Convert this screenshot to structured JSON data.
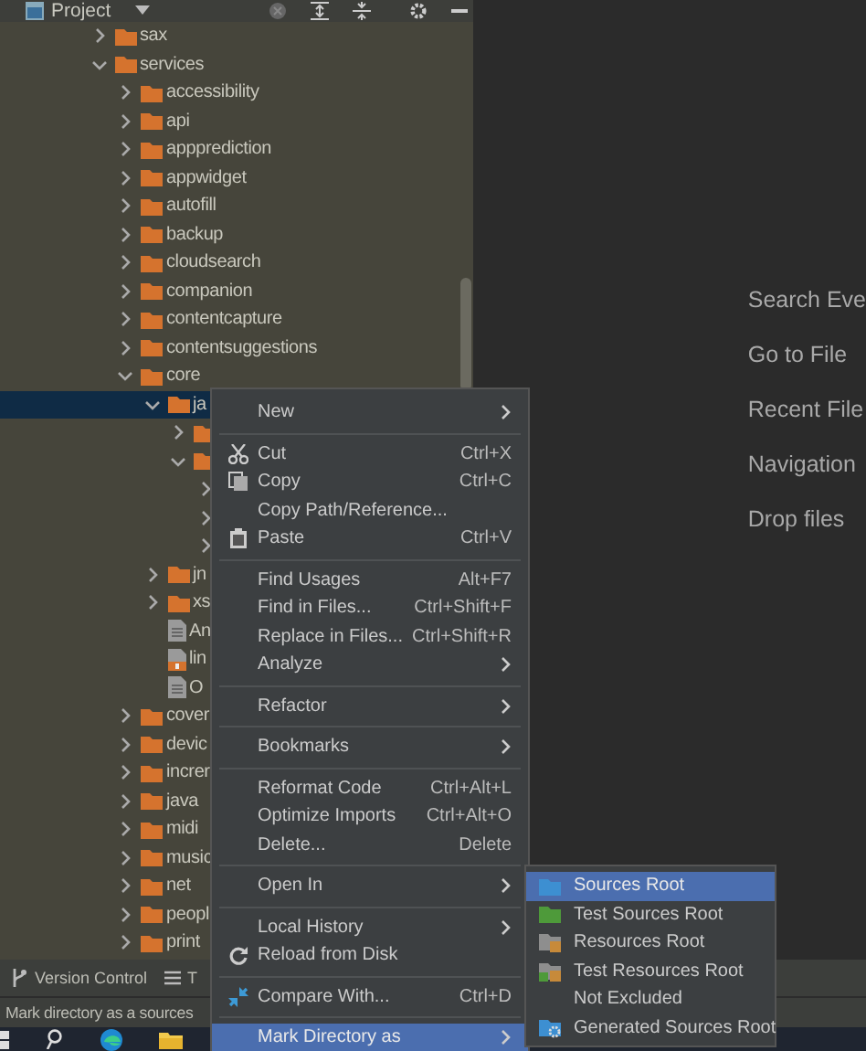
{
  "project_panel": {
    "title": "Project",
    "tree": [
      {
        "label": "sax",
        "kind": "folder",
        "expanded": false,
        "selected": false
      },
      {
        "label": "services",
        "kind": "folder",
        "expanded": true,
        "selected": false,
        "children": [
          {
            "label": "accessibility",
            "kind": "folder",
            "expanded": false,
            "selected": false
          },
          {
            "label": "api",
            "kind": "folder",
            "expanded": false,
            "selected": false
          },
          {
            "label": "appprediction",
            "kind": "folder",
            "expanded": false,
            "selected": false
          },
          {
            "label": "appwidget",
            "kind": "folder",
            "expanded": false,
            "selected": false
          },
          {
            "label": "autofill",
            "kind": "folder",
            "expanded": false,
            "selected": false
          },
          {
            "label": "backup",
            "kind": "folder",
            "expanded": false,
            "selected": false
          },
          {
            "label": "cloudsearch",
            "kind": "folder",
            "expanded": false,
            "selected": false
          },
          {
            "label": "companion",
            "kind": "folder",
            "expanded": false,
            "selected": false
          },
          {
            "label": "contentcapture",
            "kind": "folder",
            "expanded": false,
            "selected": false
          },
          {
            "label": "contentsuggestions",
            "kind": "folder",
            "expanded": false,
            "selected": false
          },
          {
            "label": "core",
            "kind": "folder",
            "expanded": true,
            "selected": false,
            "children": [
              {
                "label": "ja",
                "kind": "folder",
                "expanded": true,
                "selected": true,
                "children": [
                  {
                    "kind": "folder",
                    "expanded": false,
                    "selected": false
                  },
                  {
                    "kind": "folder",
                    "expanded": true,
                    "selected": false,
                    "children": [
                      {
                        "expanded": false,
                        "selected": false
                      },
                      {
                        "expanded": false,
                        "selected": false
                      },
                      {
                        "expanded": false,
                        "selected": false
                      }
                    ]
                  }
                ]
              },
              {
                "label": "jn",
                "kind": "folder",
                "expanded": false,
                "selected": false
              },
              {
                "label": "xs",
                "kind": "folder",
                "expanded": false,
                "selected": false
              },
              {
                "label": "An",
                "kind": "file",
                "selected": false
              },
              {
                "label": "lin",
                "kind": "archive-file",
                "selected": false
              },
              {
                "label": "O",
                "kind": "file",
                "selected": false
              }
            ]
          },
          {
            "label": "cover",
            "kind": "folder",
            "expanded": false,
            "selected": false
          },
          {
            "label": "devic",
            "kind": "folder",
            "expanded": false,
            "selected": false
          },
          {
            "label": "increr",
            "kind": "folder",
            "expanded": false,
            "selected": false
          },
          {
            "label": "java",
            "kind": "folder",
            "expanded": false,
            "selected": false
          },
          {
            "label": "midi",
            "kind": "folder",
            "expanded": false,
            "selected": false
          },
          {
            "label": "music",
            "kind": "folder",
            "expanded": false,
            "selected": false
          },
          {
            "label": "net",
            "kind": "folder",
            "expanded": false,
            "selected": false
          },
          {
            "label": "peopl",
            "kind": "folder",
            "expanded": false,
            "selected": false
          },
          {
            "label": "print",
            "kind": "folder",
            "expanded": false,
            "selected": false
          }
        ]
      }
    ]
  },
  "editor_hints": [
    "Search Eve",
    "Go to File",
    "Recent File",
    "Navigation",
    "Drop files"
  ],
  "tool_tabs": [
    {
      "label": "Version Control",
      "kind": "branch"
    },
    {
      "label": "T",
      "kind": "list"
    }
  ],
  "status_bar": "Mark directory as a sources",
  "context_menu": [
    {
      "kind": "submenu",
      "label": "New",
      "selected": false
    },
    {
      "kind": "separator"
    },
    {
      "kind": "cut",
      "label": "Cut",
      "shortcut": "Ctrl+X",
      "selected": false
    },
    {
      "kind": "copy",
      "label": "Copy",
      "shortcut": "Ctrl+C",
      "selected": false
    },
    {
      "kind": "item",
      "label": "Copy Path/Reference...",
      "selected": false
    },
    {
      "kind": "paste",
      "label": "Paste",
      "shortcut": "Ctrl+V",
      "selected": false
    },
    {
      "kind": "separator"
    },
    {
      "kind": "item",
      "label": "Find Usages",
      "shortcut": "Alt+F7",
      "selected": false
    },
    {
      "kind": "item",
      "label": "Find in Files...",
      "shortcut": "Ctrl+Shift+F",
      "selected": false
    },
    {
      "kind": "item",
      "label": "Replace in Files...",
      "shortcut": "Ctrl+Shift+R",
      "selected": false
    },
    {
      "kind": "submenu",
      "label": "Analyze",
      "selected": false
    },
    {
      "kind": "separator"
    },
    {
      "kind": "submenu",
      "label": "Refactor",
      "selected": false
    },
    {
      "kind": "separator"
    },
    {
      "kind": "submenu",
      "label": "Bookmarks",
      "selected": false
    },
    {
      "kind": "separator"
    },
    {
      "kind": "item",
      "label": "Reformat Code",
      "shortcut": "Ctrl+Alt+L",
      "selected": false
    },
    {
      "kind": "item",
      "label": "Optimize Imports",
      "shortcut": "Ctrl+Alt+O",
      "selected": false
    },
    {
      "kind": "item",
      "label": "Delete...",
      "shortcut": "Delete",
      "selected": false
    },
    {
      "kind": "separator"
    },
    {
      "kind": "submenu",
      "label": "Open In",
      "selected": false
    },
    {
      "kind": "separator"
    },
    {
      "kind": "submenu",
      "label": "Local History",
      "selected": false
    },
    {
      "kind": "reload",
      "label": "Reload from Disk",
      "selected": false
    },
    {
      "kind": "separator"
    },
    {
      "kind": "compare",
      "label": "Compare With...",
      "shortcut": "Ctrl+D",
      "selected": false
    },
    {
      "kind": "separator"
    },
    {
      "kind": "submenu",
      "label": "Mark Directory as",
      "selected": true
    }
  ],
  "submenu": [
    {
      "label": "Sources Root",
      "kind": "sources",
      "selected": true
    },
    {
      "label": "Test Sources Root",
      "kind": "tests",
      "selected": false
    },
    {
      "label": "Resources Root",
      "kind": "resources",
      "selected": false
    },
    {
      "label": "Test Resources Root",
      "kind": "testresources",
      "selected": false
    },
    {
      "label": "Not Excluded",
      "kind": "plain",
      "selected": false
    },
    {
      "label": "Generated Sources Root",
      "kind": "generated",
      "selected": false
    }
  ]
}
